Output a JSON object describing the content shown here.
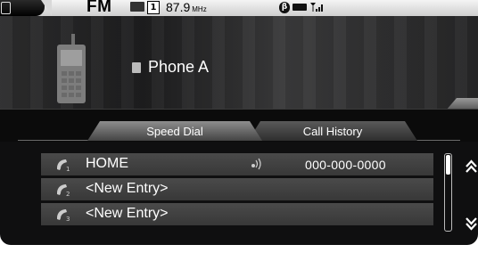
{
  "status_bar": {
    "band": "FM",
    "preset_number": "1",
    "frequency": "87.9",
    "frequency_unit": "MHz"
  },
  "phone": {
    "name": "Phone A"
  },
  "tabs": [
    {
      "label": "Speed Dial",
      "active": true
    },
    {
      "label": "Call History",
      "active": false
    }
  ],
  "speed_dial": {
    "entries": [
      {
        "index": "1",
        "label": "HOME",
        "number": "000-000-0000",
        "has_voice_tag": true
      },
      {
        "index": "2",
        "label": "<New Entry>",
        "number": "",
        "has_voice_tag": false
      },
      {
        "index": "3",
        "label": "<New Entry>",
        "number": "",
        "has_voice_tag": false
      }
    ]
  },
  "colors": {
    "background": "#0f0f10",
    "row": "#404040",
    "active_tab": "#7a7a7a",
    "text": "#ffffff"
  },
  "icons": {
    "status_phone": "phone-icon",
    "bluetooth": "bluetooth-icon",
    "battery": "battery-icon",
    "signal": "signal-icon",
    "voice_tag": "voice-tag-icon",
    "scroll_up": "scroll-up-icon",
    "scroll_down": "scroll-down-icon"
  }
}
